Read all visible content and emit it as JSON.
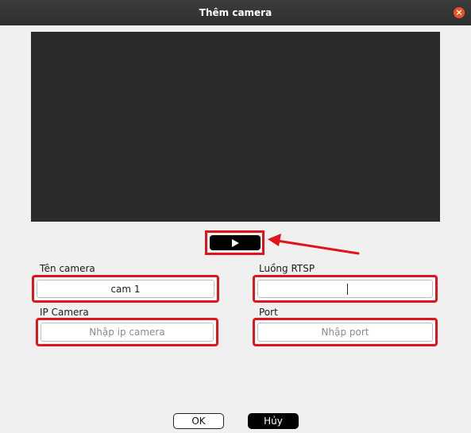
{
  "window": {
    "title": "Thêm camera",
    "close_icon": "×"
  },
  "preview": {
    "play_icon": "play-icon"
  },
  "form": {
    "camera_name": {
      "label": "Tên camera",
      "value": "cam 1"
    },
    "rtsp_stream": {
      "label": "Luồng RTSP",
      "value": ""
    },
    "ip_camera": {
      "label": "IP Camera",
      "placeholder": "Nhập ip camera"
    },
    "port": {
      "label": "Port",
      "placeholder": "Nhập port"
    }
  },
  "buttons": {
    "ok_label": "OK",
    "cancel_label": "Hủy"
  },
  "colors": {
    "highlight": "#e0141b",
    "titlebar": "#2f2f2f",
    "close": "#e95420",
    "preview_bg": "#2b2b2b"
  }
}
